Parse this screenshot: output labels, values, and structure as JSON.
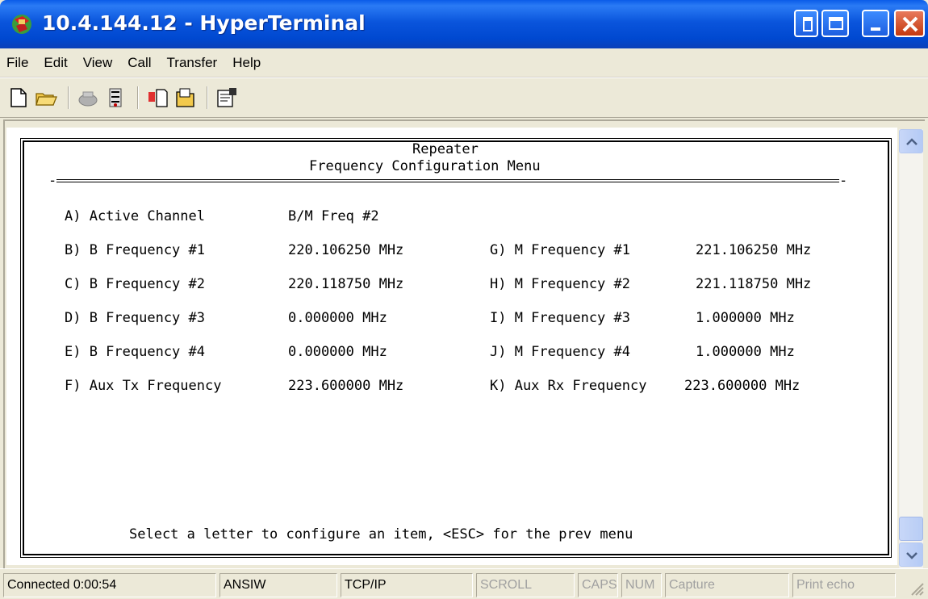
{
  "window": {
    "title": "10.4.144.12 - HyperTerminal",
    "title_color": "#0A5CE8",
    "icon": "hyperterminal-icon"
  },
  "menu": [
    "File",
    "Edit",
    "View",
    "Call",
    "Transfer",
    "Help"
  ],
  "toolbar": {
    "icons": [
      "new-icon",
      "open-icon",
      "disconnect-icon",
      "dial-icon",
      "send-icon",
      "receive-icon",
      "properties-icon"
    ]
  },
  "terminal": {
    "heading1": "Repeater",
    "heading2": "Frequency Configuration Menu",
    "active_label": "A) Active Channel",
    "active_value": "B/M Freq #2",
    "left_items": [
      {
        "label": "B) B Frequency #1",
        "value": "220.106250 MHz"
      },
      {
        "label": "C) B Frequency #2",
        "value": "220.118750 MHz"
      },
      {
        "label": "D) B Frequency #3",
        "value": "0.000000 MHz"
      },
      {
        "label": "E) B Frequency #4",
        "value": "0.000000 MHz"
      },
      {
        "label": "F) Aux Tx Frequency",
        "value": "223.600000 MHz"
      }
    ],
    "right_items": [
      {
        "label": "G) M Frequency #1",
        "value": "221.106250 MHz"
      },
      {
        "label": "H) M Frequency #2",
        "value": "221.118750 MHz"
      },
      {
        "label": "I) M Frequency #3",
        "value": "1.000000 MHz"
      },
      {
        "label": "J) M Frequency #4",
        "value": "1.000000 MHz"
      },
      {
        "label": "K) Aux Rx Frequency",
        "value": "223.600000 MHz"
      }
    ],
    "prompt": "Select a letter to configure an item, <ESC> for the prev menu"
  },
  "status": {
    "connected": "Connected 0:00:54",
    "emulation": "ANSIW",
    "connection": "TCP/IP",
    "scroll": "SCROLL",
    "caps": "CAPS",
    "num": "NUM",
    "capture": "Capture",
    "print_echo": "Print echo"
  }
}
